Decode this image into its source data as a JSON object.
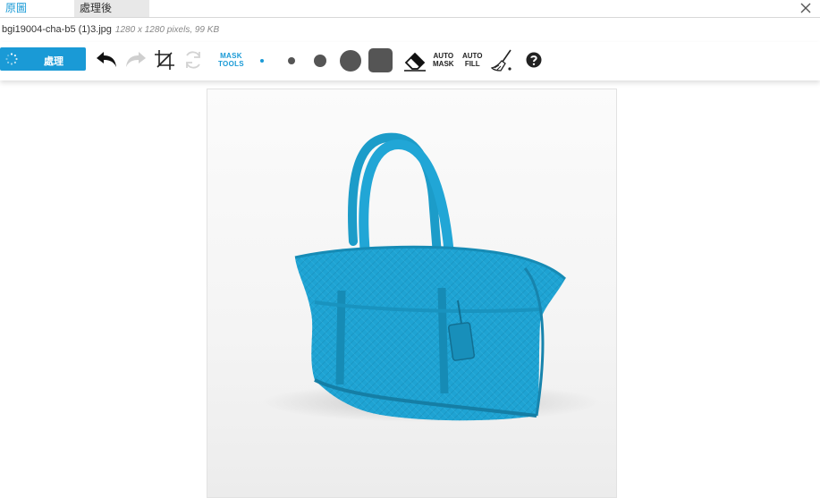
{
  "tabs": {
    "original": "原圖",
    "processed": "處理後"
  },
  "file": {
    "name": "bgi19004-cha-b5 (1)3.jpg",
    "meta": "1280 x 1280 pixels, 99 KB"
  },
  "toolbar": {
    "process_label": "處理",
    "mask_tools": [
      "MASK",
      "TOOLS"
    ],
    "auto_mask": [
      "AUTO",
      "MASK"
    ],
    "auto_fill": [
      "AUTO",
      "FILL"
    ]
  },
  "colors": {
    "accent": "#1a9ad6",
    "mask": "#1ea3d3"
  }
}
